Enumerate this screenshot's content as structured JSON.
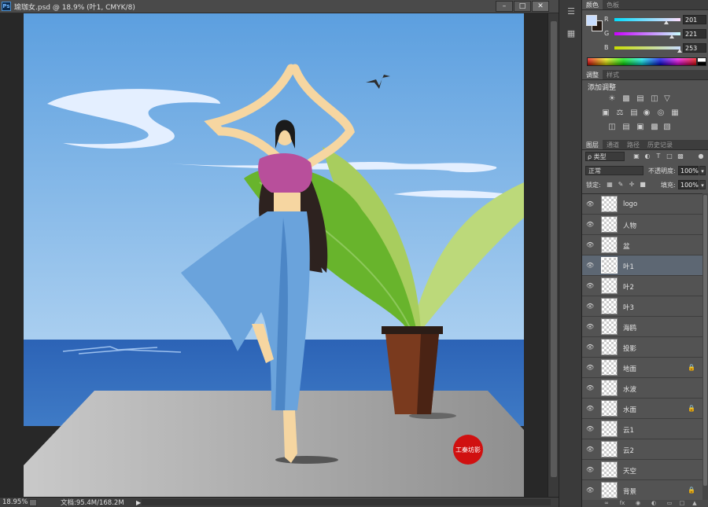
{
  "document": {
    "title": "瑜珈女.psd @ 18.9% (叶1, CMYK/8)",
    "app_badge": "Ps",
    "zoom": "18.95%",
    "doc_size": "文档:95.4M/168.2M"
  },
  "color_panel": {
    "tabs": [
      "颜色",
      "色板"
    ],
    "foreground": "#c9ddfd",
    "background": "#251a14",
    "channels": [
      {
        "label": "R",
        "value": "201",
        "level": 0.788
      },
      {
        "label": "G",
        "value": "221",
        "level": 0.867
      },
      {
        "label": "B",
        "value": "253",
        "level": 0.992
      }
    ]
  },
  "adjust_panel": {
    "tabs": [
      "调整",
      "样式"
    ],
    "heading": "添加调整"
  },
  "layers_panel": {
    "tabs": [
      "图层",
      "通道",
      "路径",
      "历史记录"
    ],
    "filter_label": "ρ 类型",
    "blend_mode": "正常",
    "opacity_label": "不透明度:",
    "opacity": "100%",
    "lock_label": "锁定:",
    "fill_label": "填充:",
    "fill": "100%",
    "layers": [
      {
        "name": "logo",
        "selected": false,
        "locked": false
      },
      {
        "name": "人物",
        "selected": false,
        "locked": false
      },
      {
        "name": "盆",
        "selected": false,
        "locked": false
      },
      {
        "name": "叶1",
        "selected": true,
        "locked": false
      },
      {
        "name": "叶2",
        "selected": false,
        "locked": false
      },
      {
        "name": "叶3",
        "selected": false,
        "locked": false
      },
      {
        "name": "海鸥",
        "selected": false,
        "locked": false
      },
      {
        "name": "投影",
        "selected": false,
        "locked": false
      },
      {
        "name": "地面",
        "selected": false,
        "locked": true
      },
      {
        "name": "水波",
        "selected": false,
        "locked": false
      },
      {
        "name": "水面",
        "selected": false,
        "locked": true
      },
      {
        "name": "云1",
        "selected": false,
        "locked": false
      },
      {
        "name": "云2",
        "selected": false,
        "locked": false
      },
      {
        "name": "天空",
        "selected": false,
        "locked": false
      },
      {
        "name": "背景",
        "selected": false,
        "locked": true
      }
    ]
  },
  "artwork": {
    "stamp_text": "工秦坊影"
  }
}
